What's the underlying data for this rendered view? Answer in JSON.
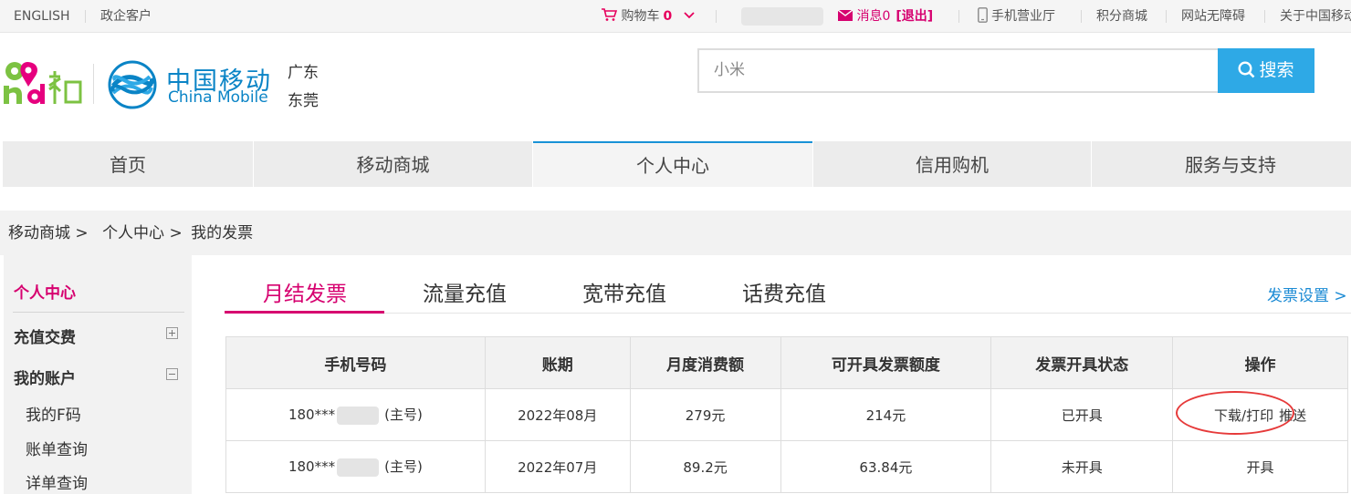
{
  "topbar": {
    "english": "ENGLISH",
    "enterprise": "政企客户",
    "cart_label": "购物车",
    "cart_count": "0",
    "messages": "消息0",
    "logout": "[退出]",
    "mobile_hall": "手机营业厅",
    "points_mall": "积分商城",
    "accessibility": "网站无障碍",
    "about": "关于中国移动"
  },
  "header": {
    "brand_cn": "中国移动",
    "brand_en": "China Mobile",
    "province": "广东",
    "city": "东莞"
  },
  "search": {
    "value": "小米",
    "button_label": "搜索"
  },
  "nav": {
    "items": [
      "首页",
      "移动商城",
      "个人中心",
      "信用购机",
      "服务与支持"
    ],
    "active": "个人中心"
  },
  "breadcrumb": {
    "items": [
      "移动商城 >",
      "个人中心 >",
      "我的发票"
    ]
  },
  "sidebar": {
    "title": "个人中心",
    "sections": [
      {
        "label": "充值交费",
        "expanded": false
      },
      {
        "label": "我的账户",
        "expanded": true
      }
    ],
    "sub_items": [
      "我的F码",
      "账单查询",
      "详单查询"
    ]
  },
  "tabs": {
    "items": [
      "月结发票",
      "流量充值",
      "宽带充值",
      "话费充值"
    ],
    "active": "月结发票",
    "settings_link": "发票设置 >"
  },
  "table": {
    "headers": [
      "手机号码",
      "账期",
      "月度消费额",
      "可开具发票额度",
      "发票开具状态",
      "操作"
    ],
    "rows": [
      {
        "phone_prefix": "180***",
        "phone_suffix": "(主号)",
        "period": "2022年08月",
        "spend": "279元",
        "limit": "214元",
        "status": "已开具",
        "actions": [
          "下载/打印",
          "推送"
        ]
      },
      {
        "phone_prefix": "180***",
        "phone_suffix": "(主号)",
        "period": "2022年07月",
        "spend": "89.2元",
        "limit": "63.84元",
        "status": "未开具",
        "actions": [
          "开具"
        ]
      }
    ]
  },
  "colors": {
    "accent_pink": "#d6006f",
    "accent_blue": "#1a8ad4",
    "search_blue": "#2ea9e6",
    "annotation_red": "#e63a3a"
  }
}
